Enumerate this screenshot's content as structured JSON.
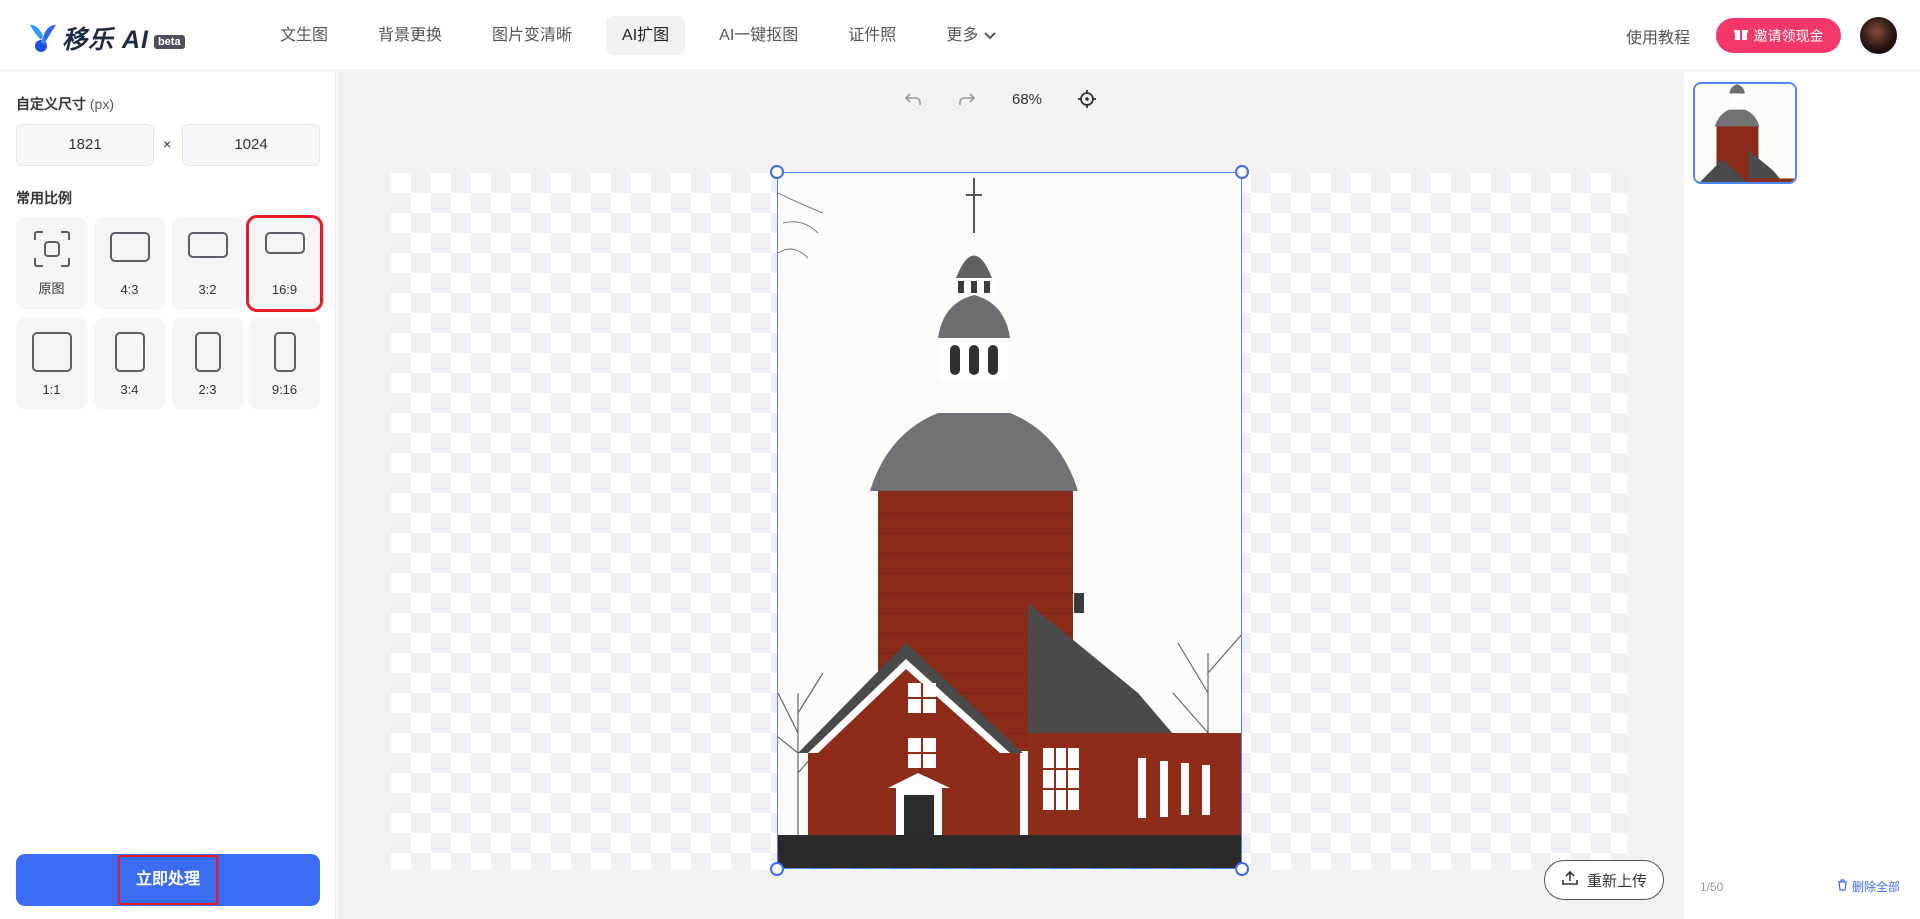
{
  "header": {
    "logo_text": "移乐 AI",
    "logo_badge": "beta",
    "nav": [
      {
        "label": "文生图"
      },
      {
        "label": "背景更换"
      },
      {
        "label": "图片变清晰"
      },
      {
        "label": "AI扩图",
        "active": true
      },
      {
        "label": "AI一键抠图"
      },
      {
        "label": "证件照"
      },
      {
        "label": "更多"
      }
    ],
    "tutorial": "使用教程",
    "invite": "邀请领现金",
    "colors": {
      "invite_bg": "#f2386a",
      "accent": "#3a6cf4"
    }
  },
  "left_panel": {
    "custom_size_title": "自定义尺寸",
    "custom_size_unit": "(px)",
    "width_value": "1821",
    "height_value": "1024",
    "times": "×",
    "ratio_title": "常用比例",
    "ratios": [
      {
        "label": "原图"
      },
      {
        "label": "4:3"
      },
      {
        "label": "3:2"
      },
      {
        "label": "16:9",
        "selected": true
      },
      {
        "label": "1:1"
      },
      {
        "label": "3:4"
      },
      {
        "label": "2:3"
      },
      {
        "label": "9:16"
      }
    ],
    "process_button": "立即处理"
  },
  "canvas": {
    "zoom": "68%",
    "reupload": "重新上传"
  },
  "right_panel": {
    "count": "1/50",
    "delete_all": "删除全部"
  }
}
